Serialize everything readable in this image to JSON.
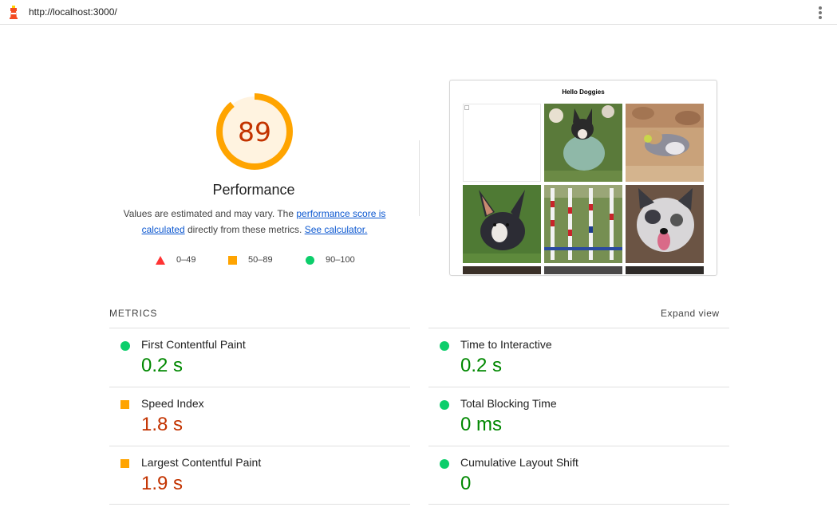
{
  "browser": {
    "url": "http://localhost:3000/",
    "logo_icon": "lighthouse-icon",
    "menu_icon": "kebab-menu-icon"
  },
  "performance": {
    "score": "89",
    "score_color": "#c33300",
    "gauge_color": "#ffa400",
    "title": "Performance",
    "desc_prefix": "Values are estimated and may vary. The ",
    "desc_link1": "performance score is calculated",
    "desc_mid": " directly from these metrics. ",
    "desc_link2": "See calculator."
  },
  "legend": [
    {
      "icon": "triangle-fail-icon",
      "label": "0–49",
      "color": "#ff3333"
    },
    {
      "icon": "square-average-icon",
      "label": "50–89",
      "color": "#ffa400"
    },
    {
      "icon": "circle-pass-icon",
      "label": "90–100",
      "color": "#0cce6b"
    }
  ],
  "screenshot": {
    "title": "Hello Doggies"
  },
  "metrics": {
    "header": "METRICS",
    "expand": "Expand view",
    "items": [
      {
        "label": "First Contentful Paint",
        "value": "0.2 s",
        "status": "pass"
      },
      {
        "label": "Time to Interactive",
        "value": "0.2 s",
        "status": "pass"
      },
      {
        "label": "Speed Index",
        "value": "1.8 s",
        "status": "average"
      },
      {
        "label": "Total Blocking Time",
        "value": "0 ms",
        "status": "pass"
      },
      {
        "label": "Largest Contentful Paint",
        "value": "1.9 s",
        "status": "average"
      },
      {
        "label": "Cumulative Layout Shift",
        "value": "0",
        "status": "pass"
      }
    ]
  },
  "colors": {
    "pass": "#0cce6b",
    "pass_text": "#008800",
    "average": "#ffa400",
    "average_text": "#c33300",
    "fail": "#ff3333"
  }
}
